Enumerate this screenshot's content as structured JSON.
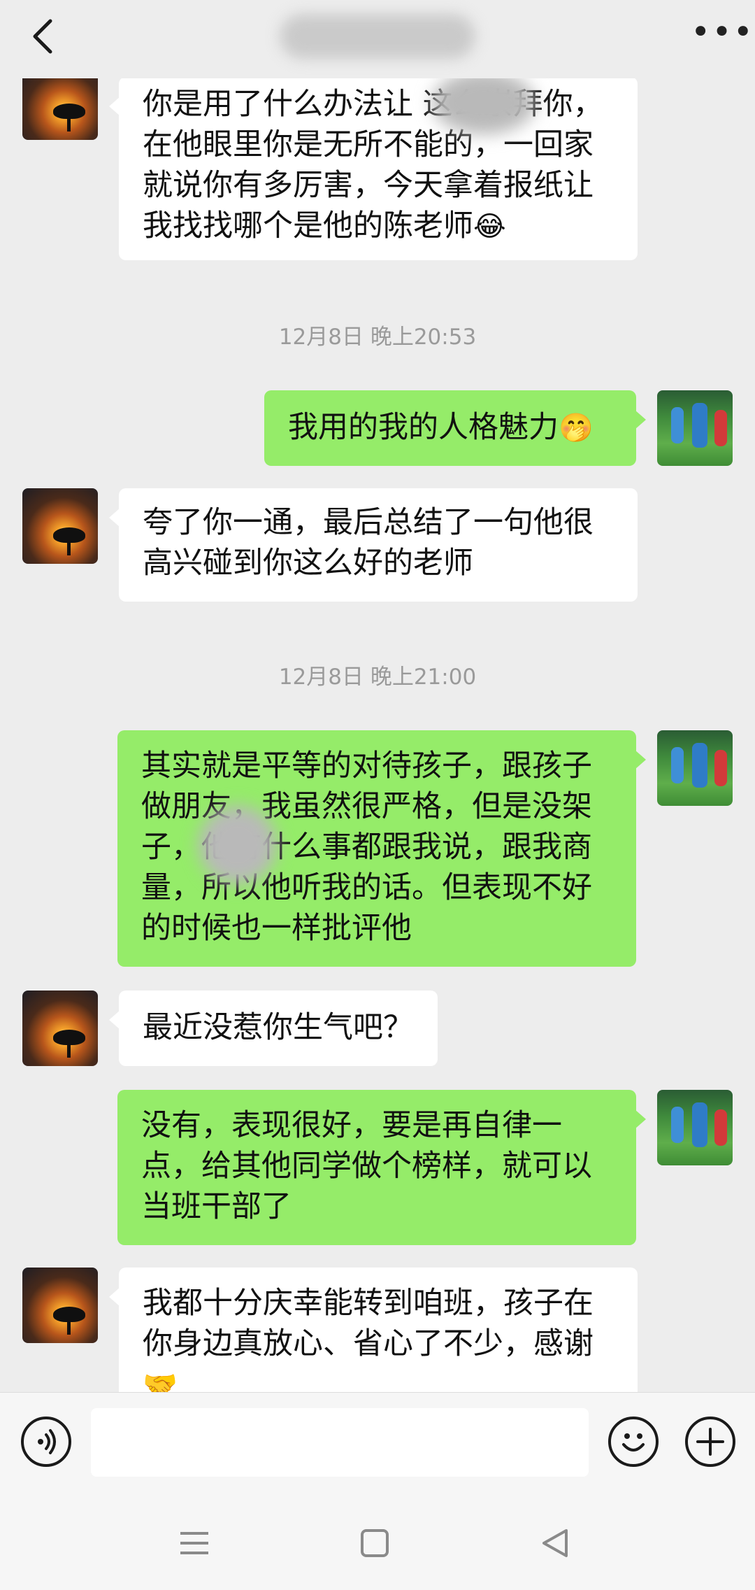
{
  "header": {
    "more_label": "•••"
  },
  "messages": [
    {
      "side": "in",
      "text": "你是用了什么办法让     这么崇拜你，在他眼里你是无所不能的，一回家就说你有多厉害，今天拿着报纸让我找找哪个是他的陈老师",
      "emoji": "😂"
    },
    {
      "timestamp": "12月8日 晚上20:53"
    },
    {
      "side": "out",
      "text": "我用的我的人格魅力",
      "emoji": "🤭"
    },
    {
      "side": "in",
      "text": "夸了你一通，最后总结了一句他很高兴碰到你这么好的老师"
    },
    {
      "timestamp": "12月8日 晚上21:00"
    },
    {
      "side": "out",
      "text": "其实就是平等的对待孩子，跟孩子做朋友，我虽然很严格，但是没架子，他有什么事都跟我说，跟我商量，所以他听我的话。但表现不好的时候也一样批评他"
    },
    {
      "side": "in",
      "text": "最近没惹你生气吧？"
    },
    {
      "side": "out",
      "text": "没有，表现很好，要是再自律一点，给其他同学做个榜样，就可以当班干部了"
    },
    {
      "side": "in",
      "text": "我都十分庆幸能转到咱班，孩子在你身边真放心、省心了不少，感谢",
      "emoji": "🤝"
    }
  ],
  "input": {
    "placeholder": ""
  },
  "icons": {
    "back": "chevron-left-icon",
    "voice": "voice-icon",
    "emoji": "emoji-icon",
    "plus": "plus-icon"
  },
  "colors": {
    "background": "#ededed",
    "bubble_in": "#ffffff",
    "bubble_out": "#95ec69",
    "timestamp": "#9a9a9a"
  }
}
